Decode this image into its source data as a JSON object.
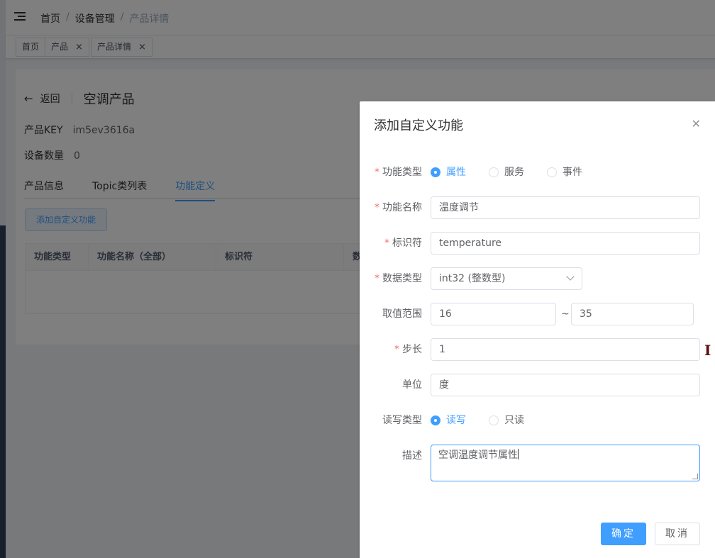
{
  "navbar": {
    "breadcrumb": [
      "首页",
      "设备管理",
      "产品详情"
    ],
    "separator": "/"
  },
  "tags": [
    {
      "label": "首页",
      "closable": false
    },
    {
      "label": "产品",
      "closable": true
    },
    {
      "label": "产品详情",
      "closable": true
    }
  ],
  "tag_close_glyph": "×",
  "page": {
    "back_label": "返回",
    "title": "空调产品",
    "product_key_label": "产品KEY",
    "product_key_value": "im5ev3616a",
    "device_count_label": "设备数量",
    "device_count_value": "0",
    "tabs": [
      "产品信息",
      "Topic类列表",
      "功能定义"
    ],
    "active_tab": "功能定义",
    "add_button": "添加自定义功能",
    "table_headers": [
      "功能类型",
      "功能名称（全部）",
      "标识符",
      "数"
    ]
  },
  "dialog": {
    "title": "添加自定义功能",
    "required_mark": "*",
    "function_type": {
      "label": "功能类型",
      "options": [
        "属性",
        "服务",
        "事件"
      ],
      "selected": "属性"
    },
    "function_name": {
      "label": "功能名称",
      "value": "温度调节"
    },
    "identifier": {
      "label": "标识符",
      "value": "temperature"
    },
    "data_type": {
      "label": "数据类型",
      "value": "int32 (整数型)"
    },
    "value_range": {
      "label": "取值范围",
      "min": "16",
      "max": "35",
      "separator": "~"
    },
    "step": {
      "label": "步长",
      "value": "1"
    },
    "unit": {
      "label": "单位",
      "value": "度"
    },
    "rw_type": {
      "label": "读写类型",
      "options": [
        "读写",
        "只读"
      ],
      "selected": "读写"
    },
    "description": {
      "label": "描述",
      "value": "空调温度调节属性"
    },
    "confirm": "确定",
    "cancel": "取消"
  },
  "colors": {
    "primary": "#409eff",
    "required": "#f56c6c",
    "sidebar": "#304156"
  },
  "icons": [
    "hamburger-icon",
    "back-arrow-icon",
    "close-icon",
    "chevron-down-icon",
    "text-cursor-icon",
    "resize-handle-icon"
  ]
}
